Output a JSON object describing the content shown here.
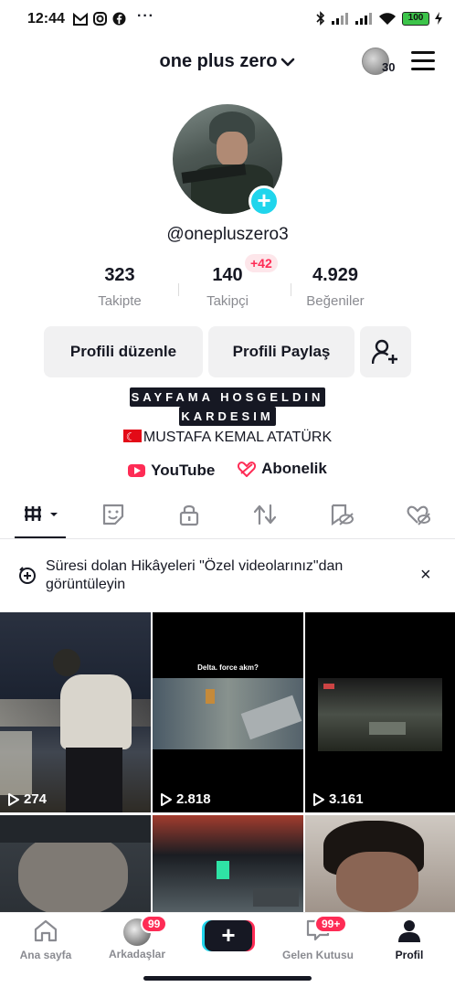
{
  "status_bar": {
    "time": "12:44",
    "dots": "···",
    "battery": "100"
  },
  "header": {
    "title": "one plus zero",
    "friends_count": "30"
  },
  "profile": {
    "handle": "@onepluszero3",
    "stats": [
      {
        "value": "323",
        "label": "Takipte"
      },
      {
        "value": "140",
        "label": "Takipçi"
      },
      {
        "value": "4.929",
        "label": "Beğeniler"
      }
    ],
    "follower_delta": "+42",
    "buttons": {
      "edit": "Profili düzenle",
      "share": "Profili Paylaş"
    },
    "bio": {
      "line1": "SAYFAMA HOSGELDIN",
      "line2": "KARDESIM",
      "line3": "MUSTAFA KEMAL ATATÜRK"
    },
    "links": {
      "youtube": "YouTube",
      "subscription": "Abonelik"
    }
  },
  "tabs": [
    "videos-grid",
    "reposts-sticker",
    "private-lock",
    "reposts",
    "hidden",
    "liked"
  ],
  "notice": {
    "text": "Süresi dolan Hikâyeleri \"Özel videolarınız\"dan görüntüleyin",
    "close": "×"
  },
  "videos": [
    {
      "views": "274"
    },
    {
      "views": "2.818",
      "caption": "Delta. force akm?"
    },
    {
      "views": "3.161"
    },
    {
      "views": ""
    },
    {
      "views": ""
    },
    {
      "views": ""
    }
  ],
  "bottom_nav": {
    "home": "Ana sayfa",
    "friends": "Arkadaşlar",
    "friends_badge": "99",
    "inbox": "Gelen Kutusu",
    "inbox_badge": "99+",
    "profile": "Profil",
    "create": "+"
  },
  "colors": {
    "accent_red": "#fe2c55",
    "accent_cyan": "#20d5ec",
    "text_primary": "#161823",
    "text_secondary": "#8a8b91"
  }
}
